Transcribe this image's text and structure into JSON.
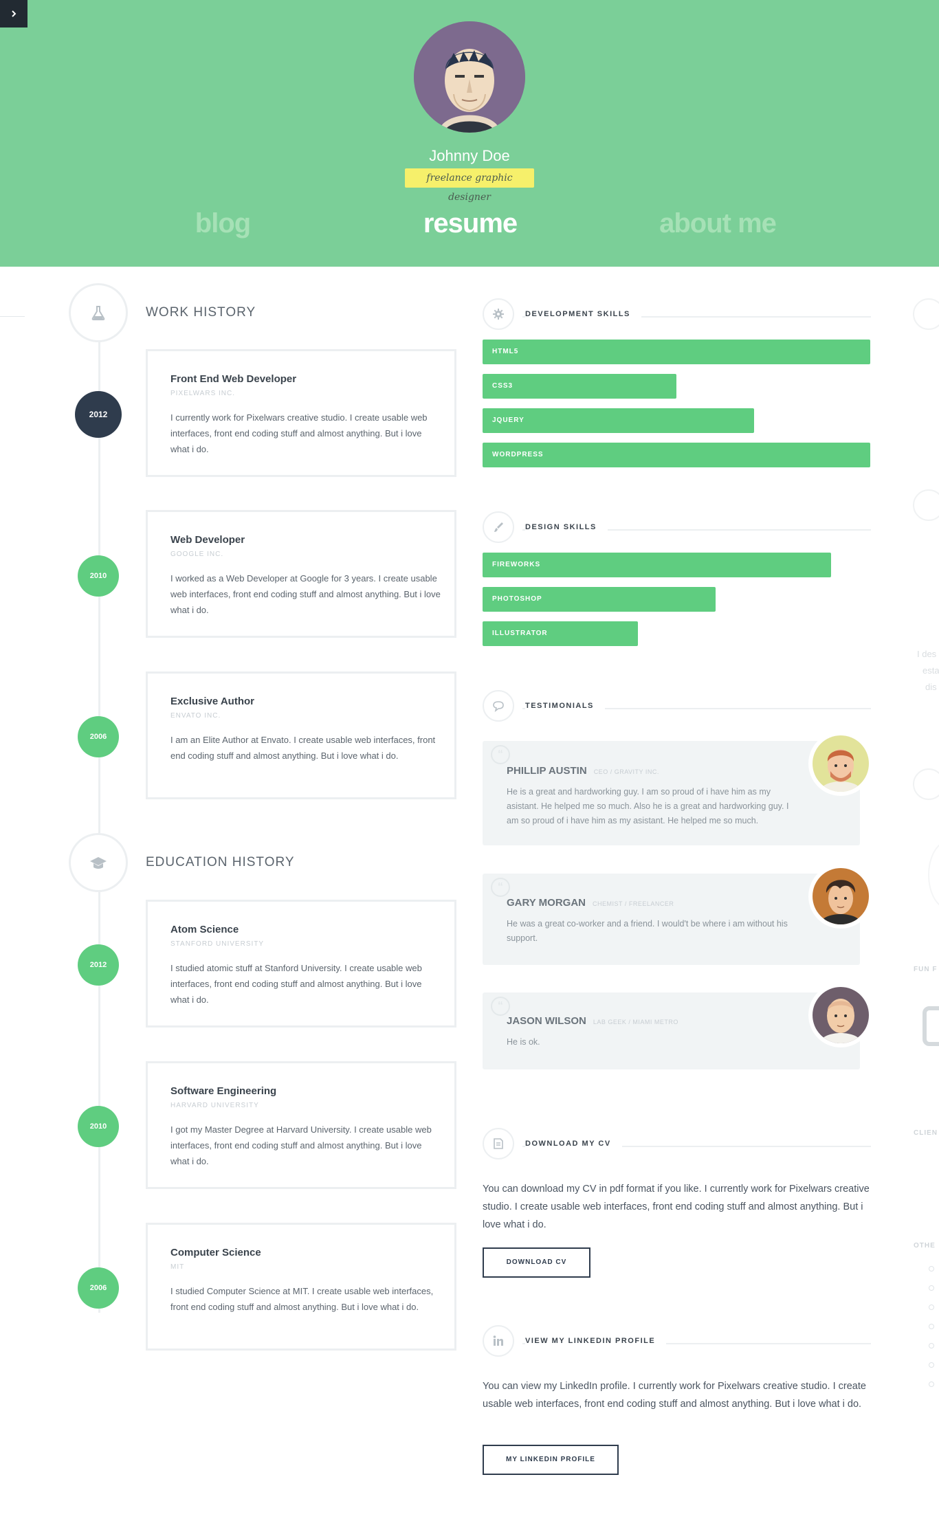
{
  "header": {
    "name": "Johnny Doe",
    "title": "freelance graphic designer",
    "nav": [
      "blog",
      "resume",
      "about me"
    ]
  },
  "work_history": {
    "title": "WORK HISTORY",
    "items": [
      {
        "year": "2012",
        "role": "Front End Web Developer",
        "company": "PIXELWARS INC.",
        "desc": "I currently work for Pixelwars creative studio. I create usable web interfaces, front end coding stuff and almost anything. But i love what i do."
      },
      {
        "year": "2010",
        "role": "Web Developer",
        "company": "GOOGLE INC.",
        "desc": "I worked as a Web Developer at Google for 3 years. I create usable web interfaces, front end coding stuff and almost anything. But i love what i do."
      },
      {
        "year": "2006",
        "role": "Exclusive Author",
        "company": "ENVATO INC.",
        "desc": "I am an Elite Author at Envato. I create usable web interfaces, front end coding stuff and almost anything. But i love what i do."
      }
    ]
  },
  "education_history": {
    "title": "EDUCATION HISTORY",
    "items": [
      {
        "year": "2012",
        "role": "Atom Science",
        "company": "STANFORD UNIVERSITY",
        "desc": "I studied atomic stuff at Stanford University. I create usable web interfaces, front end coding stuff and almost anything. But i love what i do."
      },
      {
        "year": "2010",
        "role": "Software Engineering",
        "company": "HARVARD UNIVERSITY",
        "desc": "I got my Master Degree at Harvard University. I create usable web interfaces, front end coding stuff and almost anything. But i love what i do."
      },
      {
        "year": "2006",
        "role": "Computer Science",
        "company": "MIT",
        "desc": "I studied Computer Science at MIT. I create usable web interfaces, front end coding stuff and almost anything. But i love what i do."
      }
    ]
  },
  "development_skills": {
    "title": "DEVELOPMENT SKILLS",
    "items": [
      {
        "name": "HTML5",
        "level": 1.0
      },
      {
        "name": "CSS3",
        "level": 0.5
      },
      {
        "name": "JQUERY",
        "level": 0.7
      },
      {
        "name": "WORDPRESS",
        "level": 1.0
      }
    ]
  },
  "design_skills": {
    "title": "DESIGN SKILLS",
    "items": [
      {
        "name": "FIREWORKS",
        "level": 0.9
      },
      {
        "name": "PHOTOSHOP",
        "level": 0.6
      },
      {
        "name": "ILLUSTRATOR",
        "level": 0.4
      }
    ]
  },
  "testimonials": {
    "title": "TESTIMONIALS",
    "items": [
      {
        "name": "PHILLIP AUSTIN",
        "role": "CEO / GRAVITY INC.",
        "text": "He is a great and hardworking guy. I am so proud of i have him as my asistant. He helped me so much. Also he is a great and hardworking guy. I am so proud of i have him as my asistant. He helped me so much."
      },
      {
        "name": "GARY MORGAN",
        "role": "CHEMIST / FREELANCER",
        "text": "He was a great co-worker and a friend. I would't be where i am without his support."
      },
      {
        "name": "JASON WILSON",
        "role": "LAB GEEK / MIAMI METRO",
        "text": "He is ok."
      }
    ]
  },
  "download_cv": {
    "title": "DOWNLOAD MY CV",
    "text": "You can download my CV in pdf format if you like. I currently work for Pixelwars creative studio. I create usable web interfaces, front end coding stuff and almost anything. But i love what i do.",
    "button": "DOWNLOAD CV"
  },
  "linkedin": {
    "title": "VIEW MY LINKEDIN PROFILE",
    "text": "You can view my LinkedIn profile. I currently work for Pixelwars creative studio. I create usable web interfaces, front end coding stuff and almost anything. But i love what i do.",
    "button": "MY LINKEDIN PROFILE"
  },
  "side_panel": {
    "text_lines": [
      "I des",
      "esta",
      "dis"
    ],
    "labels": [
      "FUN F",
      "CLIEN",
      "OTHE"
    ]
  },
  "colors": {
    "header_bg": "#7bcf98",
    "accent_green": "#5fcd80",
    "dark_navy": "#2f3c4d",
    "highlight_yellow": "#f6f06b"
  }
}
